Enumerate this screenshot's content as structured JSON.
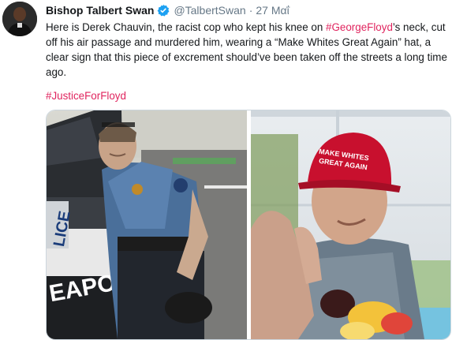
{
  "tweet": {
    "author_name": "Bishop Talbert Swan",
    "handle": "@TalbertSwan",
    "separator": "·",
    "date": "27 Μαΐ",
    "text_part1": "Here is Derek Chauvin, the racist cop who kept his knee on ",
    "text_hashtag": "#GeorgeFloyd",
    "text_part2": "’s neck, cut off his air passage and murdered him, wearing a “Make Whites Great Again” hat, a clear sign that this piece of excrement should’ve been taken off the streets a long time ago.",
    "hashtag2": "#JusticeForFloyd"
  },
  "media": {
    "left_photo": {
      "car_text_1": "LICE",
      "car_text_2": "EAPOLIS"
    },
    "right_photo": {
      "hat_text_1": "MAKE WHITES",
      "hat_text_2": "GREAT AGAIN"
    }
  },
  "colors": {
    "hashtag": "#e0245e",
    "secondary_text": "#657786",
    "verified": "#1da1f2"
  }
}
